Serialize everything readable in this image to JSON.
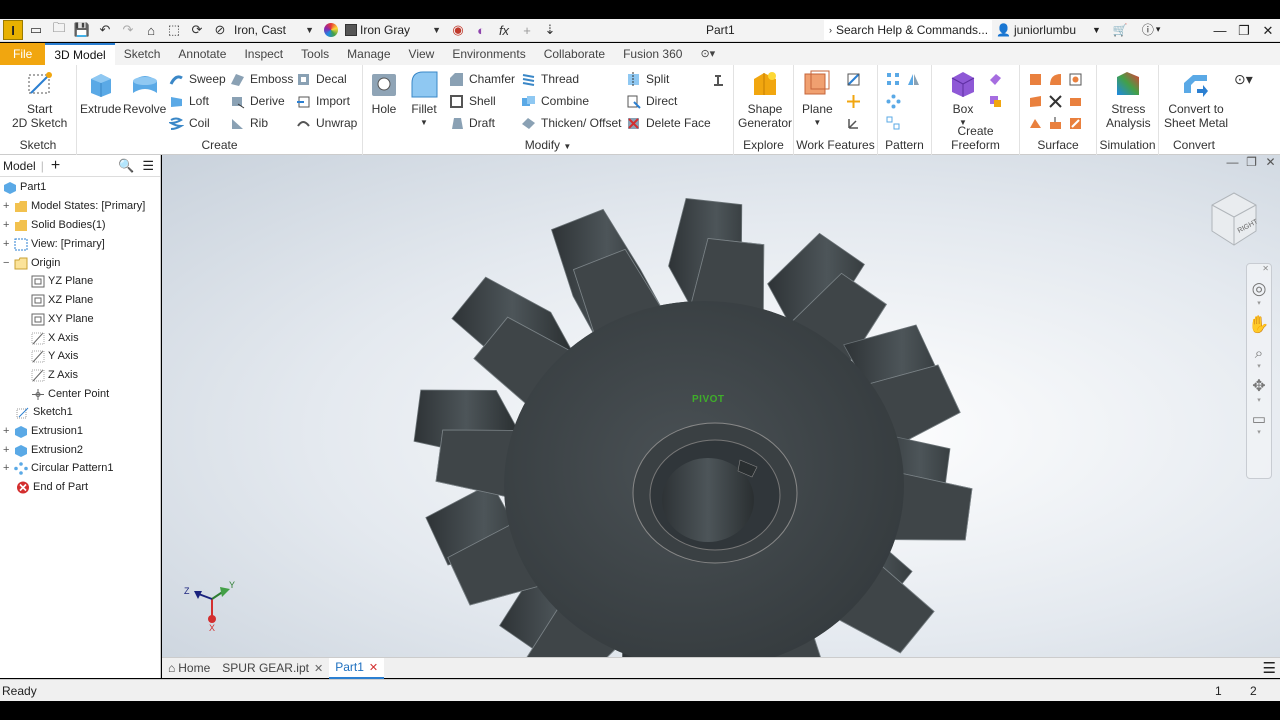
{
  "titlebar": {
    "logo": "I",
    "material": "Iron, Cast",
    "appearance": "Iron Gray",
    "doc_title": "Part1",
    "search_placeholder": "Search Help & Commands...",
    "user": "juniorlumbu"
  },
  "tabs": [
    {
      "label": "File"
    },
    {
      "label": "3D Model"
    },
    {
      "label": "Sketch"
    },
    {
      "label": "Annotate"
    },
    {
      "label": "Inspect"
    },
    {
      "label": "Tools"
    },
    {
      "label": "Manage"
    },
    {
      "label": "View"
    },
    {
      "label": "Environments"
    },
    {
      "label": "Collaborate"
    },
    {
      "label": "Fusion 360"
    }
  ],
  "ribbon": {
    "sketch": {
      "label": "Sketch",
      "start": "Start",
      "start2": "2D Sketch"
    },
    "create": {
      "label": "Create",
      "extrude": "Extrude",
      "revolve": "Revolve",
      "sweep": "Sweep",
      "loft": "Loft",
      "coil": "Coil",
      "emboss": "Emboss",
      "derive": "Derive",
      "rib": "Rib",
      "decal": "Decal",
      "import": "Import",
      "unwrap": "Unwrap"
    },
    "modify": {
      "label": "Modify",
      "hole": "Hole",
      "fillet": "Fillet",
      "chamfer": "Chamfer",
      "shell": "Shell",
      "draft": "Draft",
      "thread": "Thread",
      "combine": "Combine",
      "thicken": "Thicken/ Offset",
      "split": "Split",
      "direct": "Direct",
      "delete_face": "Delete Face"
    },
    "explore": {
      "label": "Explore",
      "shape_gen": "Shape",
      "shape_gen2": "Generator"
    },
    "work": {
      "label": "Work Features",
      "plane": "Plane"
    },
    "pattern": {
      "label": "Pattern"
    },
    "freeform": {
      "label": "Create Freeform",
      "box": "Box"
    },
    "surface": {
      "label": "Surface"
    },
    "simulation": {
      "label": "Simulation",
      "stress": "Stress",
      "stress2": "Analysis"
    },
    "convert": {
      "label": "Convert",
      "sheet": "Convert to",
      "sheet2": "Sheet Metal"
    }
  },
  "browser": {
    "title": "Model",
    "items": [
      {
        "label": "Part1"
      },
      {
        "label": "Model States: [Primary]"
      },
      {
        "label": "Solid Bodies(1)"
      },
      {
        "label": "View: [Primary]"
      },
      {
        "label": "Origin"
      },
      {
        "label": "YZ Plane"
      },
      {
        "label": "XZ Plane"
      },
      {
        "label": "XY Plane"
      },
      {
        "label": "X Axis"
      },
      {
        "label": "Y Axis"
      },
      {
        "label": "Z Axis"
      },
      {
        "label": "Center Point"
      },
      {
        "label": "Sketch1"
      },
      {
        "label": "Extrusion1"
      },
      {
        "label": "Extrusion2"
      },
      {
        "label": "Circular Pattern1"
      },
      {
        "label": "End of Part"
      }
    ]
  },
  "viewport": {
    "pivot": "PIVOT",
    "viewcube_face": "RIGHT",
    "triad": {
      "x": "X",
      "y": "Y",
      "z": "Z"
    }
  },
  "doctabs": {
    "home": "Home",
    "tab1": "SPUR GEAR.ipt",
    "tab2": "Part1"
  },
  "status": {
    "text": "Ready",
    "n1": "1",
    "n2": "2"
  },
  "colors": {
    "accent": "#2b7fd1",
    "file_tab": "#f1a60f",
    "gear": "#3f4548"
  }
}
